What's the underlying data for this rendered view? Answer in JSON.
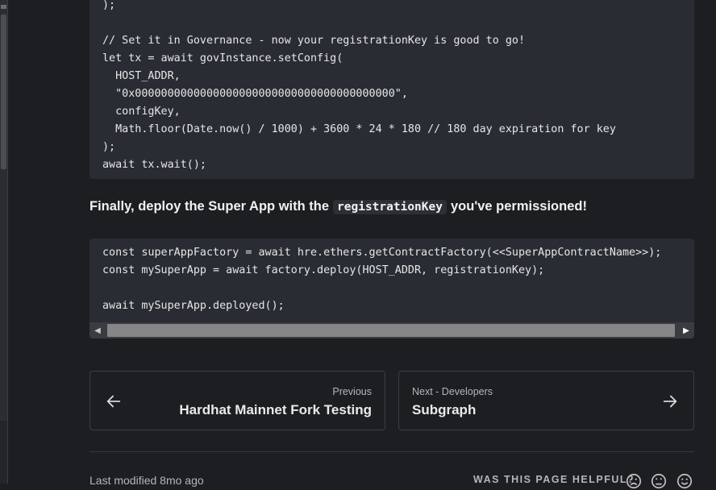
{
  "code_block_1": {
    "lines": [
      ");",
      "",
      "// Set it in Governance - now your registrationKey is good to go!",
      "let tx = await govInstance.setConfig(",
      "  HOST_ADDR,",
      "  \"0x0000000000000000000000000000000000000000\",",
      "  configKey,",
      "  Math.floor(Date.now() / 1000) + 3600 * 24 * 180 // 180 day expiration for key",
      ");",
      "await tx.wait();"
    ]
  },
  "callout": {
    "before": "Finally, deploy the Super App with the",
    "code": "registrationKey",
    "after": "you've permissioned!"
  },
  "code_block_2": {
    "lines": [
      "const superAppFactory = await hre.ethers.getContractFactory(<<SuperAppContractName>>);",
      "const mySuperApp = await factory.deploy(HOST_ADDR, registrationKey);",
      "",
      "await mySuperApp.deployed();"
    ]
  },
  "pagination": {
    "previous": {
      "sub": "Previous",
      "title": "Hardhat Mainnet Fork Testing",
      "icon": "arrow-left-icon"
    },
    "next": {
      "sub": "Next - Developers",
      "title": "Subgraph",
      "icon": "arrow-right-icon"
    }
  },
  "footer": {
    "last_modified": "Last modified 8mo ago",
    "helpful_label": "WAS THIS PAGE HELPFUL?",
    "feedback_icons": [
      "sad-face-icon",
      "neutral-face-icon",
      "happy-face-icon"
    ]
  }
}
